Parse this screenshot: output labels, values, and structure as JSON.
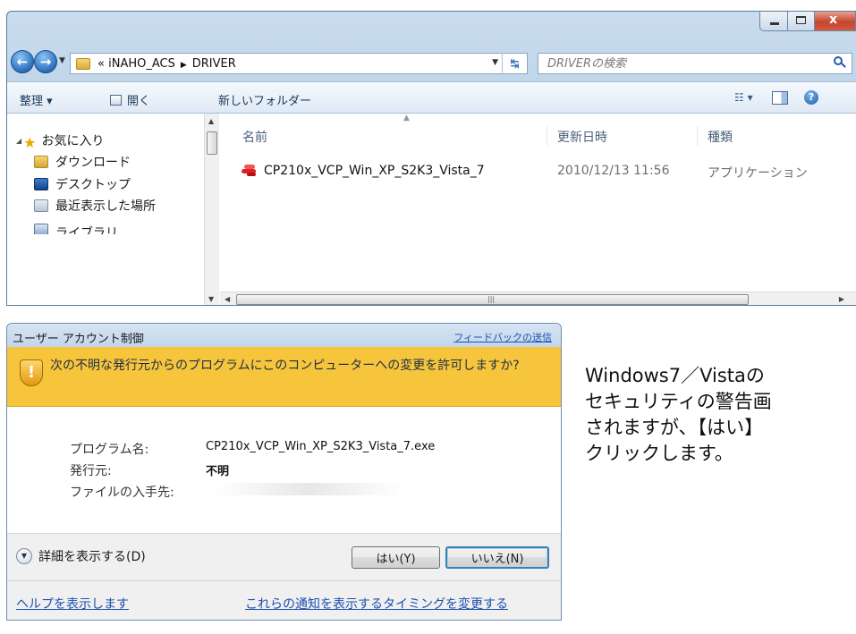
{
  "explorer": {
    "address": {
      "root_marker": "«",
      "path_parts": [
        "iNAHO_ACS",
        "DRIVER"
      ]
    },
    "search": {
      "placeholder": "DRIVERの検索"
    },
    "commandbar": {
      "organize": "整理 ▾",
      "open": "開く",
      "new_folder": "新しいフォルダー"
    },
    "navpane": {
      "favorites": "お気に入り",
      "items": [
        "ダウンロード",
        "デスクトップ",
        "最近表示した場所"
      ],
      "libraries": "ライブラリ"
    },
    "columns": {
      "name": "名前",
      "date": "更新日時",
      "type": "種類"
    },
    "files": [
      {
        "name": "CP210x_VCP_Win_XP_S2K3_Vista_7",
        "date": "2010/12/13 11:56",
        "type": "アプリケーション"
      }
    ]
  },
  "uac": {
    "title": "ユーザー アカウント制御",
    "feedback_link": "フィードバックの送信",
    "question": "次の不明な発行元からのプログラムにこのコンピューターへの変更を許可しますか?",
    "program_label": "プログラム名:",
    "program_value": "CP210x_VCP_Win_XP_S2K3_Vista_7.exe",
    "publisher_label": "発行元:",
    "publisher_value": "不明",
    "source_label": "ファイルの入手先:",
    "details": "詳細を表示する(D)",
    "yes_button": "はい(Y)",
    "no_button": "いいえ(N)",
    "help_link": "ヘルプを表示します",
    "timing_link": "これらの通知を表示するタイミングを変更する"
  },
  "description": {
    "lines": [
      "Windows7／Vistaの",
      "セキュリティの警告画",
      "されますが、【はい】",
      "クリックします。"
    ]
  },
  "colors": {
    "banner": "#f7c53c",
    "link": "#1d4fae",
    "titlebar": "#c3d6ec"
  }
}
